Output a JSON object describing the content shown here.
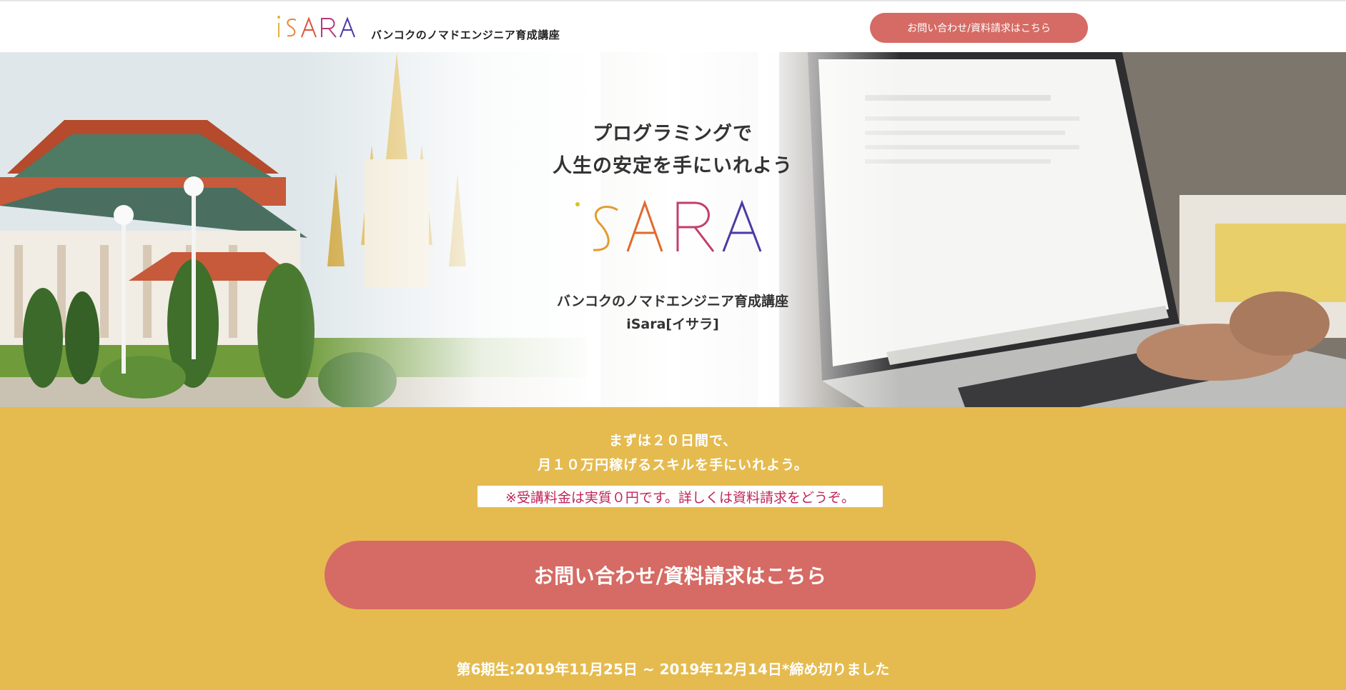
{
  "header": {
    "logo_text": "iSARA",
    "tagline": "バンコクのノマドエンジニア育成講座",
    "cta_label": "お問い合わせ/資料請求はこちら"
  },
  "hero": {
    "headline_line1": "プログラミングで",
    "headline_line2": "人生の安定を手にいれよう",
    "logo_text": "iSARA",
    "sub_line1": "バンコクのノマドエンジニア育成講座",
    "sub_line2": "iSara[イサラ]",
    "images": [
      "temple-photo",
      "laptop-photo"
    ]
  },
  "band": {
    "line1": "まずは２０日間で、",
    "line2": "月１０万円稼げるスキルを手にいれよう。",
    "notice": "※受講料金は実質０円です。詳しくは資料請求をどうぞ。",
    "cta_label": "お問い合わせ/資料請求はこちら",
    "term": "第6期生:2019年11月25日 ~ 2019年12月14日*締め切りました"
  },
  "colors": {
    "accent_cta": "#d56b64",
    "band_yellow": "#e5bb4f",
    "notice_text": "#c0245a"
  }
}
